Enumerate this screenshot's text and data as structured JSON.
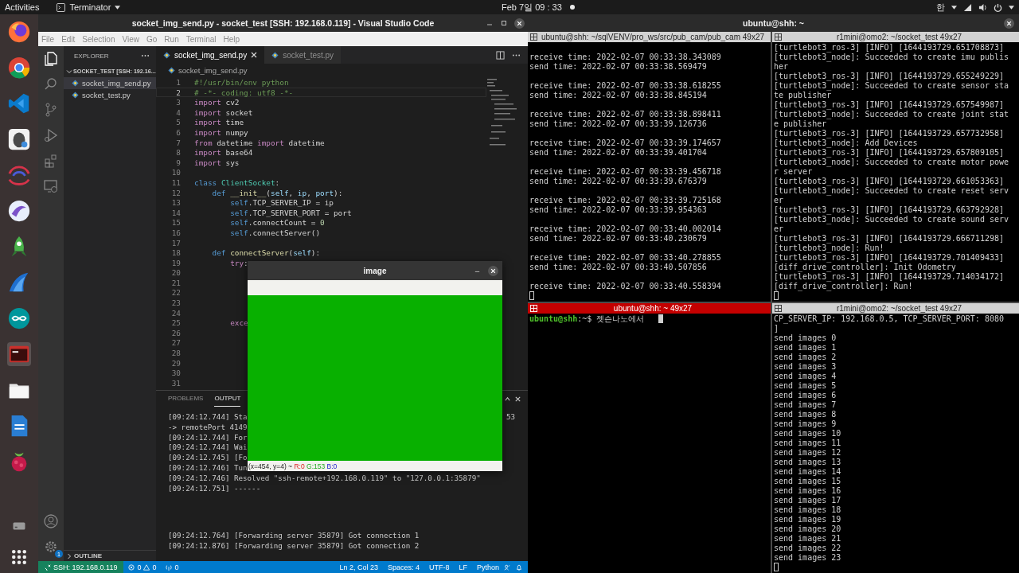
{
  "top_bar": {
    "activities": "Activities",
    "app_menu": "Terminator",
    "clock": "Feb 7일 09 : 33",
    "input_method": "한"
  },
  "vscode": {
    "title": "socket_img_send.py - socket_test [SSH: 192.168.0.119] - Visual Studio Code",
    "menu": [
      "File",
      "Edit",
      "Selection",
      "View",
      "Go",
      "Run",
      "Terminal",
      "Help"
    ],
    "explorer": {
      "title": "EXPLORER",
      "folder": {
        "label": "SOCKET_TEST [SSH: 192.16...",
        "expanded": true,
        "files": [
          {
            "label": "socket_img_send.py",
            "selected": true
          },
          {
            "label": "socket_test.py",
            "selected": false
          }
        ]
      },
      "outline": {
        "label": "OUTLINE",
        "expanded": false
      }
    },
    "settings_badge": "1",
    "tabs": [
      {
        "label": "socket_img_send.py",
        "selected": true
      },
      {
        "label": "socket_test.py",
        "selected": false
      }
    ],
    "breadcrumb": "socket_img_send.py",
    "code_lines": [
      {
        "number": "1",
        "current": false,
        "tokens": [
          {
            "text": "#!/usr/bin/env python",
            "kind": "comment"
          }
        ]
      },
      {
        "number": "2",
        "current": true,
        "tokens": [
          {
            "text": "# -*- coding: utf8 -*-",
            "kind": "comment"
          }
        ]
      },
      {
        "number": "3",
        "current": false,
        "tokens": [
          {
            "text": "import",
            "kind": "keyword"
          },
          {
            "text": " cv2",
            "kind": "plain"
          }
        ]
      },
      {
        "number": "4",
        "current": false,
        "tokens": [
          {
            "text": "import",
            "kind": "keyword"
          },
          {
            "text": " socket",
            "kind": "plain"
          }
        ]
      },
      {
        "number": "5",
        "current": false,
        "tokens": [
          {
            "text": "import",
            "kind": "keyword"
          },
          {
            "text": " time",
            "kind": "plain"
          }
        ]
      },
      {
        "number": "6",
        "current": false,
        "tokens": [
          {
            "text": "import",
            "kind": "keyword"
          },
          {
            "text": " numpy",
            "kind": "plain"
          }
        ]
      },
      {
        "number": "7",
        "current": false,
        "tokens": [
          {
            "text": "from",
            "kind": "keyword"
          },
          {
            "text": " datetime ",
            "kind": "plain"
          },
          {
            "text": "import",
            "kind": "keyword"
          },
          {
            "text": " datetime",
            "kind": "plain"
          }
        ]
      },
      {
        "number": "8",
        "current": false,
        "tokens": [
          {
            "text": "import",
            "kind": "keyword"
          },
          {
            "text": " base64",
            "kind": "plain"
          }
        ]
      },
      {
        "number": "9",
        "current": false,
        "tokens": [
          {
            "text": "import",
            "kind": "keyword"
          },
          {
            "text": " sys",
            "kind": "plain"
          }
        ]
      },
      {
        "number": "10",
        "current": false
      },
      {
        "number": "11",
        "current": false,
        "tokens": [
          {
            "text": "class",
            "kind": "storage"
          },
          {
            "text": " ClientSocket",
            "kind": "type"
          },
          {
            "text": ":",
            "kind": "plain"
          }
        ]
      },
      {
        "number": "12",
        "current": false,
        "tokens": [
          {
            "text": "    def",
            "kind": "storage"
          },
          {
            "text": " __init__",
            "kind": "func"
          },
          {
            "text": "(",
            "kind": "plain"
          },
          {
            "text": "self",
            "kind": "param"
          },
          {
            "text": ", ",
            "kind": "plain"
          },
          {
            "text": "ip",
            "kind": "param"
          },
          {
            "text": ", ",
            "kind": "plain"
          },
          {
            "text": "port",
            "kind": "param"
          },
          {
            "text": "):",
            "kind": "plain"
          }
        ]
      },
      {
        "number": "13",
        "current": false,
        "tokens": [
          {
            "text": "        self",
            "kind": "storage"
          },
          {
            "text": ".TCP_SERVER_IP = ip",
            "kind": "plain"
          }
        ]
      },
      {
        "number": "14",
        "current": false,
        "tokens": [
          {
            "text": "        self",
            "kind": "storage"
          },
          {
            "text": ".TCP_SERVER_PORT = port",
            "kind": "plain"
          }
        ]
      },
      {
        "number": "15",
        "current": false,
        "tokens": [
          {
            "text": "        self",
            "kind": "storage"
          },
          {
            "text": ".connectCount = ",
            "kind": "plain"
          },
          {
            "text": "0",
            "kind": "number"
          }
        ]
      },
      {
        "number": "16",
        "current": false,
        "tokens": [
          {
            "text": "        self",
            "kind": "storage"
          },
          {
            "text": ".connectServer()",
            "kind": "plain"
          }
        ]
      },
      {
        "number": "17",
        "current": false
      },
      {
        "number": "18",
        "current": false,
        "tokens": [
          {
            "text": "    def",
            "kind": "storage"
          },
          {
            "text": " connectServer",
            "kind": "func"
          },
          {
            "text": "(",
            "kind": "plain"
          },
          {
            "text": "self",
            "kind": "param"
          },
          {
            "text": "):",
            "kind": "plain"
          }
        ]
      },
      {
        "number": "19",
        "current": false,
        "tokens": [
          {
            "text": "        try",
            "kind": "keyword"
          },
          {
            "text": ":",
            "kind": "plain"
          }
        ]
      },
      {
        "number": "20",
        "current": false
      },
      {
        "number": "21",
        "current": false
      },
      {
        "number": "22",
        "current": false
      },
      {
        "number": "23",
        "current": false
      },
      {
        "number": "24",
        "current": false
      },
      {
        "number": "25",
        "current": false,
        "tokens": [
          {
            "text": "        exce",
            "kind": "keyword"
          }
        ]
      },
      {
        "number": "26",
        "current": false
      },
      {
        "number": "27",
        "current": false
      },
      {
        "number": "28",
        "current": false
      },
      {
        "number": "29",
        "current": false
      },
      {
        "number": "30",
        "current": false
      },
      {
        "number": "31",
        "current": false
      }
    ],
    "panel": {
      "tabs": [
        {
          "label": "PROBLEMS",
          "selected": false
        },
        {
          "label": "OUTPUT",
          "selected": true
        }
      ],
      "output_groups": [
        [
          {
            "text": "[09:24:12.744] Sta",
            "tail": "53"
          },
          {
            "text": "-> remotePort 4149"
          },
          {
            "text": "[09:24:12.744] For"
          },
          {
            "text": "[09:24:12.744] Wai"
          },
          {
            "text": "[09:24:12.745] [Fo"
          },
          {
            "text": "[09:24:12.746] Tun"
          },
          {
            "text": "[09:24:12.746] Resolved \"ssh-remote+192.168.0.119\" to \"127.0.0.1:35879\""
          },
          {
            "text": "[09:24:12.751] ------"
          }
        ],
        [
          {
            "text": "[09:24:12.764] [Forwarding server 35879] Got connection 1"
          },
          {
            "text": "[09:24:12.876] [Forwarding server 35879] Got connection 2"
          }
        ]
      ]
    },
    "status_bar": {
      "remote": "SSH: 192.168.0.119",
      "errors": "0",
      "warnings": "0",
      "ports": "0",
      "position": "Ln 2, Col 23",
      "indent": "Spaces: 4",
      "encoding": "UTF-8",
      "eol": "LF",
      "language": "Python"
    }
  },
  "image_window": {
    "title": "image",
    "readout": {
      "position": "(x=454, y=4) ~",
      "red": "R:0",
      "green": "G:153",
      "blue": "B:0"
    }
  },
  "terminator": {
    "title": "ubuntu@shh: ~",
    "panes": [
      {
        "kind": "paired",
        "title": "ubuntu@shh: ~/sqlVENV/pro_ws/src/pub_cam/pub_cam 49x27",
        "focused": false,
        "blocks": [
          [
            "receive time: 2022-02-07 00:33:38.343089",
            "send time: 2022-02-07 00:33:38.569479"
          ],
          [
            "receive time: 2022-02-07 00:33:38.618255",
            "send time: 2022-02-07 00:33:38.845194"
          ],
          [
            "receive time: 2022-02-07 00:33:38.898411",
            "send time: 2022-02-07 00:33:39.126736"
          ],
          [
            "receive time: 2022-02-07 00:33:39.174657",
            "send time: 2022-02-07 00:33:39.401704"
          ],
          [
            "receive time: 2022-02-07 00:33:39.456718",
            "send time: 2022-02-07 00:33:39.676379"
          ],
          [
            "receive time: 2022-02-07 00:33:39.725168",
            "send time: 2022-02-07 00:33:39.954363"
          ],
          [
            "receive time: 2022-02-07 00:33:40.002014",
            "send time: 2022-02-07 00:33:40.230679"
          ],
          [
            "receive time: 2022-02-07 00:33:40.278855",
            "send time: 2022-02-07 00:33:40.507856"
          ],
          [
            "receive time: 2022-02-07 00:33:40.558394"
          ]
        ]
      },
      {
        "kind": "log",
        "title": "r1mini@omo2: ~/socket_test 49x27",
        "focused": false,
        "lines": [
          "[turtlebot3_ros-3] [INFO] [1644193729.651708873]",
          "[turtlebot3_node]: Succeeded to create imu publis",
          "her",
          "[turtlebot3_ros-3] [INFO] [1644193729.655249229]",
          "[turtlebot3_node]: Succeeded to create sensor sta",
          "te publisher",
          "[turtlebot3_ros-3] [INFO] [1644193729.657549987]",
          "[turtlebot3_node]: Succeeded to create joint stat",
          "e publisher",
          "[turtlebot3_ros-3] [INFO] [1644193729.657732958]",
          "[turtlebot3_node]: Add Devices",
          "[turtlebot3_ros-3] [INFO] [1644193729.657809105]",
          "[turtlebot3_node]: Succeeded to create motor powe",
          "r server",
          "[turtlebot3_ros-3] [INFO] [1644193729.661053363]",
          "[turtlebot3_node]: Succeeded to create reset serv",
          "er",
          "[turtlebot3_ros-3] [INFO] [1644193729.663792928]",
          "[turtlebot3_node]: Succeeded to create sound serv",
          "er",
          "[turtlebot3_ros-3] [INFO] [1644193729.666711298]",
          "[turtlebot3_node]: Run!",
          "[turtlebot3_ros-3] [INFO] [1644193729.701409433]",
          "[diff_drive_controller]: Init Odometry",
          "[turtlebot3_ros-3] [INFO] [1644193729.714034172]",
          "[diff_drive_controller]: Run!"
        ]
      },
      {
        "kind": "shell",
        "title": "ubuntu@shh: ~ 49x27",
        "focused": true,
        "prompt": {
          "user": "ubuntu@shh",
          "path": ":~",
          "symbol": "$",
          "input": "젯슨나노에서"
        }
      },
      {
        "kind": "log",
        "title": "r1mini@omo2: ~/socket_test 49x27",
        "focused": false,
        "lines": [
          "CP_SERVER_IP: 192.168.0.5, TCP_SERVER_PORT: 8080",
          "]",
          "send images 0",
          "send images 1",
          "send images 2",
          "send images 3",
          "send images 4",
          "send images 5",
          "send images 6",
          "send images 7",
          "send images 8",
          "send images 9",
          "send images 10",
          "send images 11",
          "send images 12",
          "send images 13",
          "send images 14",
          "send images 15",
          "send images 16",
          "send images 17",
          "send images 18",
          "send images 19",
          "send images 20",
          "send images 21",
          "send images 22",
          "send images 23"
        ]
      }
    ]
  }
}
